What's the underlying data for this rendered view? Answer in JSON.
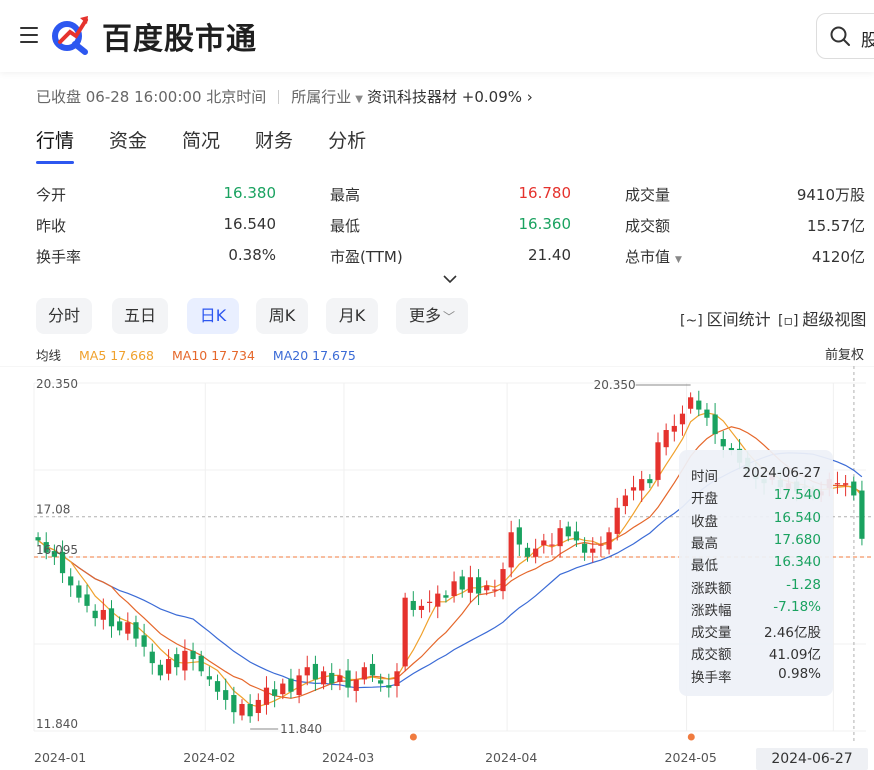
{
  "header": {
    "brand": "百度股市通",
    "search_text": "股"
  },
  "status": {
    "market": "已收盘 06-28 16:00:00 北京时间",
    "industry_label": "所属行业",
    "industry_name": "资讯科技器材",
    "industry_change": "+0.09%"
  },
  "tabs": [
    "行情",
    "资金",
    "简况",
    "财务",
    "分析"
  ],
  "quote": {
    "open_label": "今开",
    "open": "16.380",
    "prev_close_label": "昨收",
    "prev_close": "16.540",
    "turnover_label": "换手率",
    "turnover": "0.38%",
    "high_label": "最高",
    "high": "16.780",
    "low_label": "最低",
    "low": "16.360",
    "pe_label": "市盈(TTM)",
    "pe": "21.40",
    "volume_label": "成交量",
    "volume": "9410万股",
    "amount_label": "成交额",
    "amount": "15.57亿",
    "mktcap_label": "总市值",
    "mktcap": "4120亿"
  },
  "periods": [
    "分时",
    "五日",
    "日K",
    "周K",
    "月K",
    "更多"
  ],
  "tools": {
    "range_stats": "区间统计",
    "super_view": "超级视图"
  },
  "ma": {
    "label": "均线",
    "ma5": "MA5 17.668",
    "ma10": "MA10 17.734",
    "ma20": "MA20 17.675",
    "adjust": "前复权"
  },
  "colors": {
    "up": "#e5322d",
    "down": "#1aa260",
    "ma5": "#f0a12c",
    "ma10": "#e5672b",
    "ma20": "#3b6bd6",
    "accent": "#2d57f0"
  },
  "chart_data": {
    "type": "candlestick",
    "y_labels": [
      "20.350",
      "17.08",
      "16.095",
      "11.840"
    ],
    "max_label": "20.350",
    "min_label": "11.840",
    "x_labels": [
      "2024-01",
      "2024-02",
      "2024-03",
      "2024-04",
      "2024-05",
      "2024-06"
    ],
    "crosshair_date": "2024-06-27",
    "ylim": [
      11.84,
      20.35
    ],
    "close_series": [
      16.5,
      16.2,
      16.1,
      15.7,
      15.4,
      15.1,
      14.9,
      14.6,
      14.8,
      14.4,
      14.3,
      14.5,
      14.1,
      13.9,
      13.5,
      13.2,
      13.6,
      13.4,
      13.8,
      13.6,
      13.3,
      13.1,
      12.8,
      12.6,
      12.3,
      12.5,
      12.2,
      12.6,
      12.9,
      12.7,
      13.0,
      12.8,
      13.2,
      13.4,
      13.1,
      13.3,
      13.0,
      13.2,
      12.9,
      13.1,
      13.4,
      13.2,
      13.0,
      12.9,
      13.3,
      15.1,
      14.8,
      14.9,
      15.0,
      15.2,
      15.1,
      15.5,
      15.3,
      15.6,
      15.2,
      15.4,
      15.3,
      15.8,
      16.7,
      16.4,
      16.1,
      16.3,
      16.5,
      16.4,
      16.8,
      16.6,
      16.5,
      16.2,
      16.3,
      16.4,
      16.7,
      17.3,
      17.6,
      17.8,
      18.0,
      17.9,
      18.9,
      19.2,
      19.3,
      19.6,
      20.0,
      19.7,
      19.5,
      19.1,
      18.8,
      18.7,
      18.4,
      18.2,
      18.0,
      17.9,
      18.1,
      17.8,
      17.9,
      17.7,
      17.8,
      17.6,
      17.7,
      18.0,
      17.9,
      17.9,
      17.6,
      16.54
    ],
    "ma5_end": 17.668,
    "ma10_end": 17.734,
    "ma20_end": 17.675
  },
  "tooltip": {
    "rows": [
      {
        "label": "时间",
        "value": "2024-06-27"
      },
      {
        "label": "开盘",
        "value": "17.540"
      },
      {
        "label": "收盘",
        "value": "16.540"
      },
      {
        "label": "最高",
        "value": "17.680"
      },
      {
        "label": "最低",
        "value": "16.340"
      },
      {
        "label": "涨跌额",
        "value": "-1.28"
      },
      {
        "label": "涨跌幅",
        "value": "-7.18%"
      },
      {
        "label": "成交量",
        "value": "2.46亿股"
      },
      {
        "label": "成交额",
        "value": "41.09亿"
      },
      {
        "label": "换手率",
        "value": "0.98%"
      }
    ]
  }
}
